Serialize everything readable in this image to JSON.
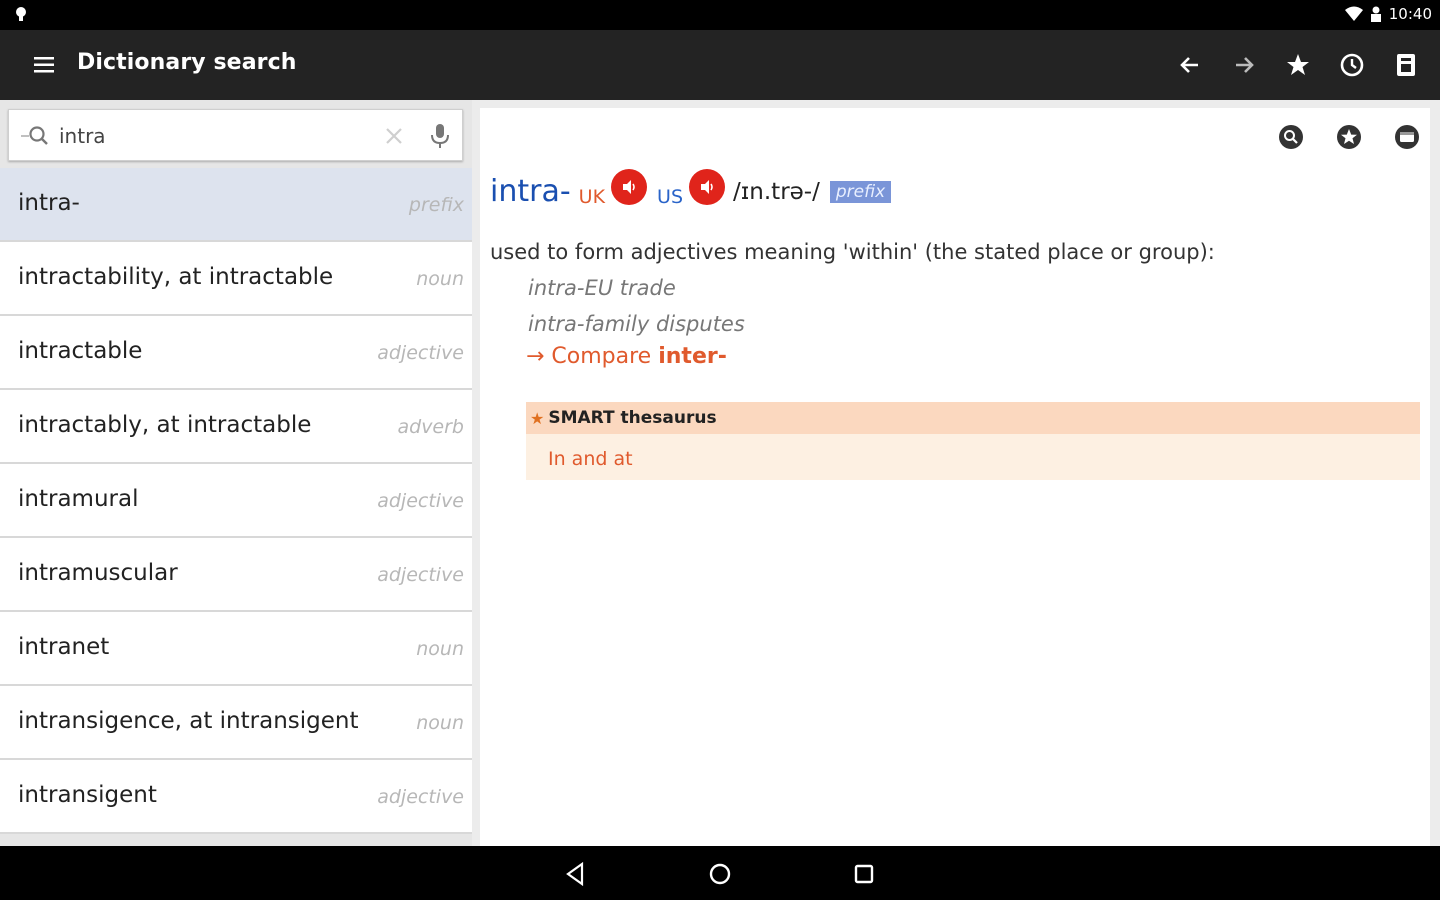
{
  "status_bar": {
    "time": "10:40",
    "icons": [
      "notification-icon",
      "wifi-icon",
      "person-icon"
    ]
  },
  "toolbar": {
    "title": "Dictionary search",
    "icons": [
      "menu-icon",
      "back-arrow-icon",
      "forward-arrow-icon",
      "star-icon",
      "history-icon",
      "save-icon"
    ]
  },
  "search": {
    "value": "intra",
    "icons": [
      "search-icon",
      "clear-icon",
      "mic-icon"
    ]
  },
  "results": [
    {
      "word": "intra-",
      "pos": "prefix",
      "selected": true
    },
    {
      "word": "intractability, at intractable",
      "pos": "noun"
    },
    {
      "word": "intractable",
      "pos": "adjective"
    },
    {
      "word": "intractably, at intractable",
      "pos": "adverb"
    },
    {
      "word": "intramural",
      "pos": "adjective"
    },
    {
      "word": "intramuscular",
      "pos": "adjective"
    },
    {
      "word": "intranet",
      "pos": "noun"
    },
    {
      "word": "intransigence, at intransigent",
      "pos": "noun"
    },
    {
      "word": "intransigent",
      "pos": "adjective"
    }
  ],
  "entry": {
    "tools": [
      "zoom-icon",
      "favorite-icon",
      "display-icon"
    ],
    "headword": "intra-",
    "uk_label": "UK",
    "us_label": "US",
    "ipa": "/ɪn.trə-/",
    "pos": "prefix",
    "definition": "used to form adjectives meaning 'within' (the stated place or group):",
    "examples": [
      "intra-EU trade",
      "intra-family disputes"
    ],
    "xref_prefix": "→ Compare ",
    "xref_word": "inter-",
    "smart_thesaurus": {
      "title": "SMART thesaurus",
      "link": "In and at"
    }
  },
  "colors": {
    "toolbar": "#232323",
    "headword": "#1a4fb0",
    "accent": "#e05a2d",
    "audio": "#e0241b",
    "selected_row": "#dde3ee"
  }
}
